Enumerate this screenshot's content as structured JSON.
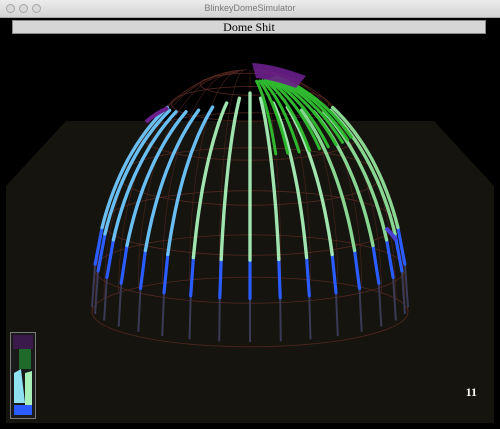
{
  "window": {
    "title": "BlinkeyDomeSimulator"
  },
  "header": {
    "label": "Dome Shit"
  },
  "status": {
    "frame_counter": "11"
  },
  "colors": {
    "background": "#000000",
    "floor": "#15140f",
    "wire": "#5a2a22",
    "strip_blue": "#2a5cff",
    "strip_mint": "#a8f0b8",
    "strip_green": "#2fb82f",
    "strip_purple": "#6a1f8a",
    "strip_cyan": "#6fc8ff"
  },
  "icons": {
    "close": "traffic-close-icon",
    "minimize": "traffic-minimize-icon",
    "maximize": "traffic-maximize-icon"
  }
}
